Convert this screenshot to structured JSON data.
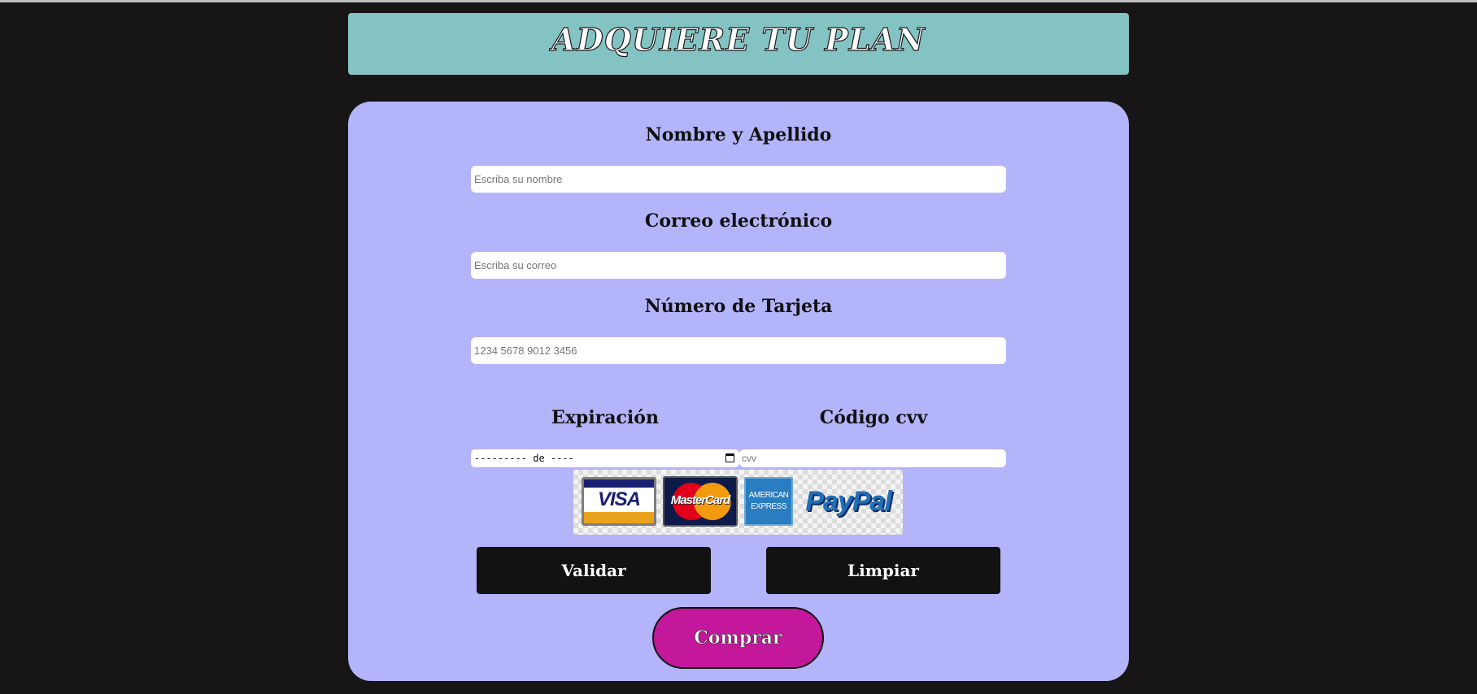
{
  "header": {
    "title": "ADQUIERE TU PLAN"
  },
  "form": {
    "name": {
      "label": "Nombre y Apellido",
      "placeholder": "Escriba su nombre"
    },
    "email": {
      "label": "Correo electrónico",
      "placeholder": "Escriba su correo"
    },
    "card_number": {
      "label": "Número de Tarjeta",
      "placeholder": "1234 5678 9012 3456"
    },
    "expiration": {
      "label": "Expiración",
      "value": "--------- de ----"
    },
    "cvv": {
      "label": "Código cvv",
      "placeholder": "cvv"
    }
  },
  "payment_logos": {
    "visa": "VISA",
    "mastercard": "MasterCard",
    "amex_line1": "AMERICAN",
    "amex_line2": "EXPRESS",
    "paypal": "PayPal"
  },
  "buttons": {
    "validate": "Validar",
    "clear": "Limpiar",
    "buy": "Comprar"
  },
  "colors": {
    "background": "#171516",
    "header": "#84c3c4",
    "card": "#b4b4fa",
    "button": "#121212",
    "buy_button": "#c3189b"
  }
}
